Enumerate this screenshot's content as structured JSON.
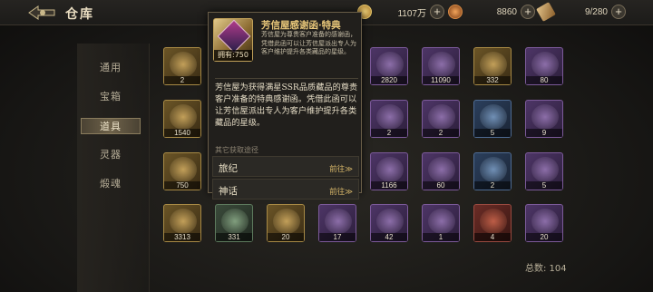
{
  "header": {
    "title": "仓库",
    "resources": [
      {
        "icon": "gold-coin-icon",
        "value": "1107万",
        "color": "#c9a04a"
      },
      {
        "icon": "jade-icon",
        "value": "8860",
        "color": "#c47a2c"
      },
      {
        "icon": "scroll-icon",
        "value": "9/280",
        "color": "#b48a4a"
      }
    ]
  },
  "tabs": [
    {
      "label": "通用",
      "active": false
    },
    {
      "label": "宝箱",
      "active": false
    },
    {
      "label": "道具",
      "active": true
    },
    {
      "label": "灵器",
      "active": false
    },
    {
      "label": "煅魂",
      "active": false
    }
  ],
  "items": [
    {
      "count": "2",
      "rarity": "gold"
    },
    {
      "count": "",
      "rarity": "purple"
    },
    {
      "count": "",
      "rarity": "purple"
    },
    {
      "count": "",
      "rarity": "purple"
    },
    {
      "count": "2820",
      "rarity": "purple"
    },
    {
      "count": "11090",
      "rarity": "purple"
    },
    {
      "count": "332",
      "rarity": "gold"
    },
    {
      "count": "80",
      "rarity": "purple"
    },
    {
      "count": "1540",
      "rarity": "gold"
    },
    {
      "count": "",
      "rarity": "purple"
    },
    {
      "count": "",
      "rarity": "purple"
    },
    {
      "count": "",
      "rarity": "purple"
    },
    {
      "count": "2",
      "rarity": "purple"
    },
    {
      "count": "2",
      "rarity": "purple"
    },
    {
      "count": "5",
      "rarity": "blue"
    },
    {
      "count": "9",
      "rarity": "purple"
    },
    {
      "count": "750",
      "rarity": "gold"
    },
    {
      "count": "",
      "rarity": "purple"
    },
    {
      "count": "",
      "rarity": "purple"
    },
    {
      "count": "",
      "rarity": "purple"
    },
    {
      "count": "1166",
      "rarity": "purple"
    },
    {
      "count": "60",
      "rarity": "purple"
    },
    {
      "count": "2",
      "rarity": "blue"
    },
    {
      "count": "5",
      "rarity": "purple"
    },
    {
      "count": "3313",
      "rarity": "gold"
    },
    {
      "count": "331",
      "rarity": "green"
    },
    {
      "count": "20",
      "rarity": "gold"
    },
    {
      "count": "17",
      "rarity": "purple"
    },
    {
      "count": "42",
      "rarity": "purple"
    },
    {
      "count": "1",
      "rarity": "purple"
    },
    {
      "count": "4",
      "rarity": "red"
    },
    {
      "count": "20",
      "rarity": "purple"
    }
  ],
  "total_label": "总数: 104",
  "tooltip": {
    "name": "芳信屋感谢函·特典",
    "owned": "拥有:750",
    "short_desc": "芳信屋为尊贵客户准备的感谢函，凭借此函可以让芳信屋派出专人为客户维护提升各类藏品的星级。",
    "description": "芳信屋为获得满星SSR品质藏品的尊贵客户准备的特典感谢函。凭借此函可以让芳信屋派出专人为客户维护提升各类藏品的星级。",
    "section_title": "其它获取途径",
    "sources": [
      {
        "label": "旅纪",
        "action": "前往≫"
      },
      {
        "label": "神话",
        "action": "前往≫"
      }
    ]
  }
}
